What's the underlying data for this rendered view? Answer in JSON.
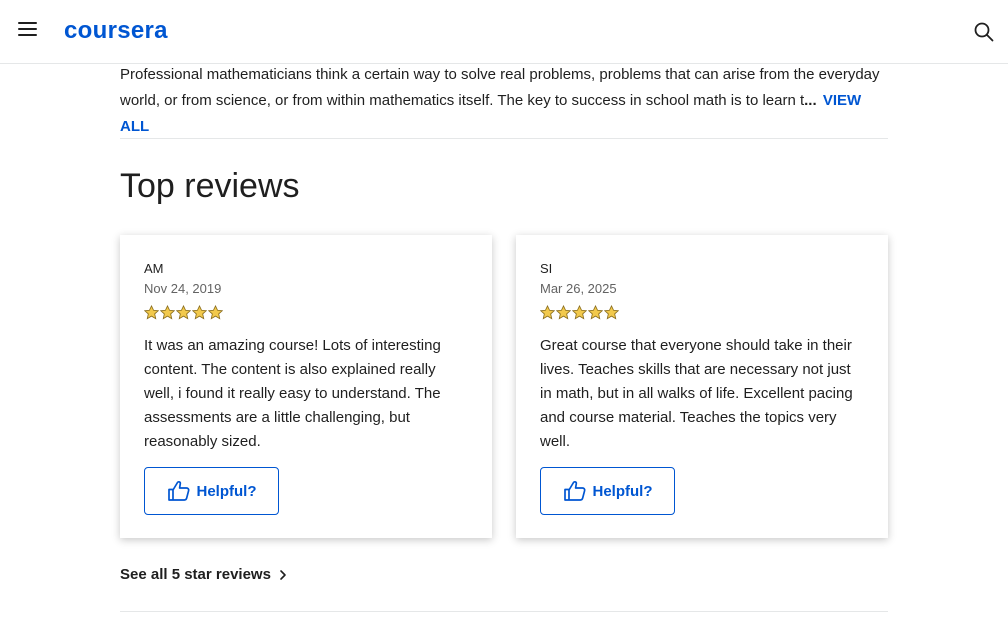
{
  "header": {
    "logo_text": "coursera",
    "menu_icon": "hamburger-menu-icon",
    "search_icon": "search-icon"
  },
  "about": {
    "text": "Professional mathematicians think a certain way to solve real problems, problems that can arise from the everyday world, or from science, or from within mathematics itself. The key to success in school math is to learn t",
    "ellipsis": "...",
    "view_all_label": "VIEW ALL"
  },
  "reviews_section": {
    "title": "Top reviews",
    "reviews": [
      {
        "reviewer": "AM",
        "date": "Nov 24, 2019",
        "rating": 5,
        "text": "It was an amazing course! Lots of interesting content. The content is also explained really well, i found it really easy to understand. The assessments are a little challenging, but reasonably sized.",
        "helpful_label": "Helpful?"
      },
      {
        "reviewer": "SI",
        "date": "Mar 26, 2025",
        "rating": 5,
        "text": "Great course that everyone should take in their lives. Teaches skills that are necessary not just in math, but in all walks of life. Excellent pacing and course material. Teaches the topics very well.",
        "helpful_label": "Helpful?"
      }
    ],
    "see_all_label": "See all 5 star reviews"
  },
  "colors": {
    "brand_blue": "#0056d2",
    "star_gold": "#f2c94c",
    "star_outline": "#8a6d1d"
  }
}
